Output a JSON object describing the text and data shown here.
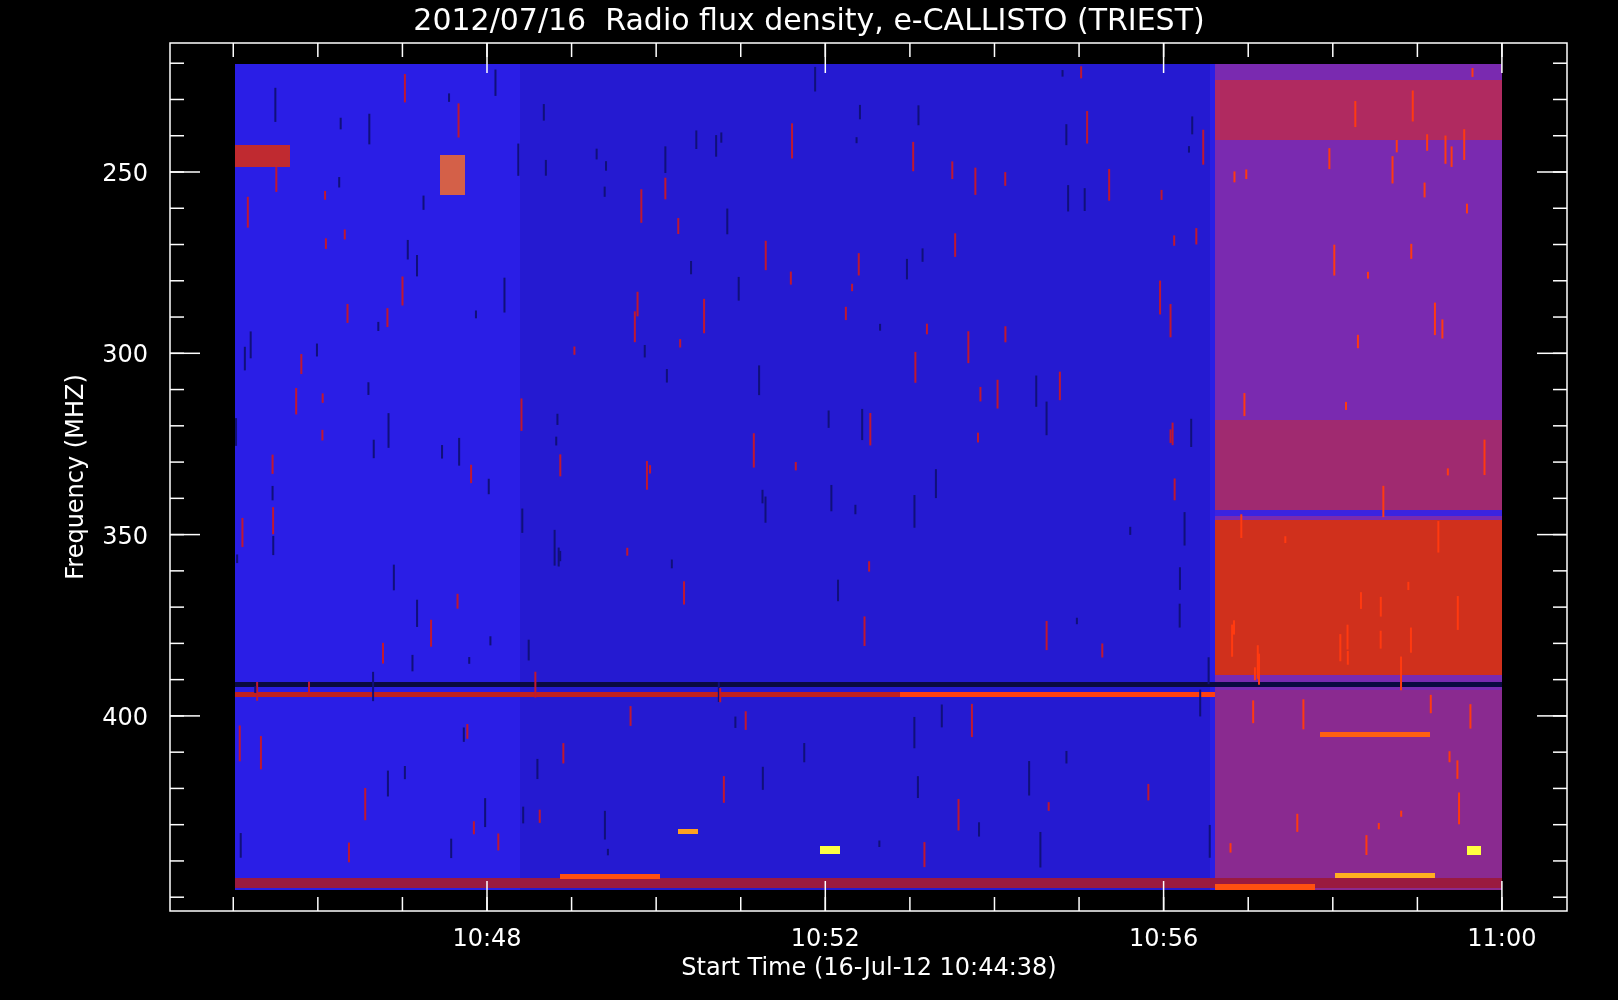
{
  "title": "2012/07/16  Radio flux density, e-CALLISTO (TRIEST)",
  "ylabel": "Frequency (MHZ)",
  "xlabel": "Start Time (16-Jul-12 10:44:38)",
  "y_tick_labels": [
    "250",
    "300",
    "350",
    "400"
  ],
  "x_tick_labels": [
    "10:48",
    "10:52",
    "10:56",
    "11:00"
  ]
}
